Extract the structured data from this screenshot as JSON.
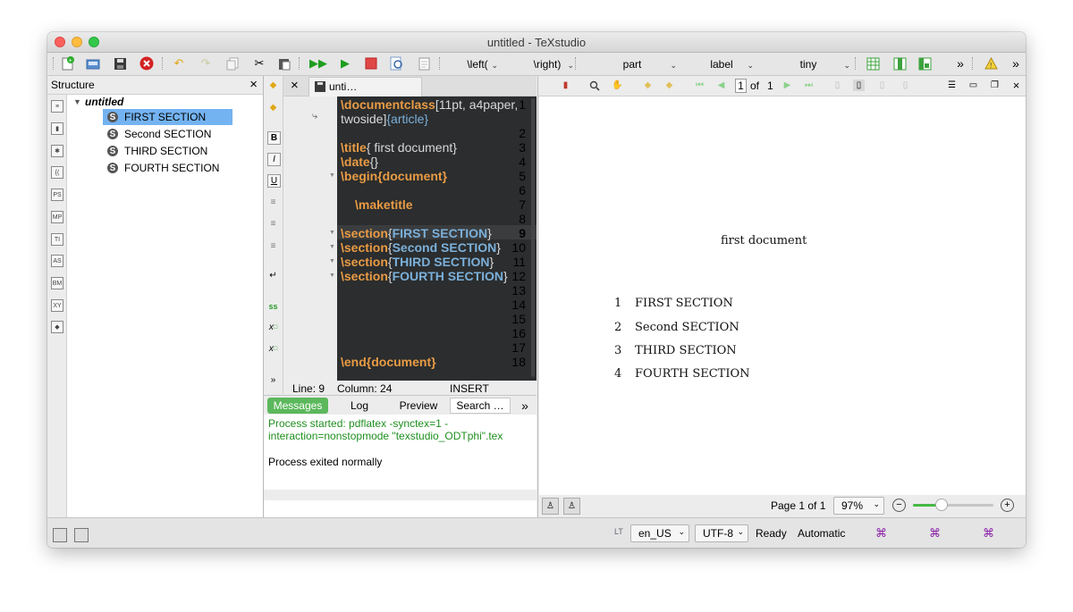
{
  "window": {
    "title": "untitled - TeXstudio"
  },
  "toolbar": {
    "left_cmd": "\\left(",
    "right_cmd": "\\right)",
    "sectioning": "part",
    "reference": "label",
    "size": "tiny",
    "more": "»"
  },
  "structure": {
    "title": "Structure",
    "close": "×",
    "root": "untitled",
    "items": [
      "FIRST SECTION",
      "Second SECTION",
      "THIRD SECTION",
      "FOURTH SECTION"
    ]
  },
  "editor": {
    "tab_close": "×",
    "tab_label": "unti…",
    "lines": [
      "1",
      "2",
      "3",
      "4",
      "5",
      "6",
      "7",
      "8",
      "9",
      "10",
      "11",
      "12",
      "13",
      "14",
      "15",
      "16",
      "17",
      "18"
    ],
    "code": {
      "l1a": "\\documentclass",
      "l1b": "[11pt, a4paper,",
      "l1c": "twoside]",
      "l1d": "{article}",
      "l3a": "\\title",
      "l3b": "{ first document}",
      "l4a": "\\date",
      "l4b": "{}",
      "l5a": "\\begin",
      "l5b": "{document}",
      "l7": "\\maketitle",
      "sec": "\\section",
      "s1": "FIRST SECTION",
      "s2": "Second SECTION",
      "s3": "THIRD SECTION",
      "s4": "FOURTH SECTION",
      "l18a": "\\end",
      "l18b": "{document}"
    },
    "status": {
      "line": "Line: 9",
      "column": "Column: 24",
      "mode": "INSERT"
    }
  },
  "messages": {
    "tabs": [
      "Messages",
      "Log",
      "Preview",
      "Search …"
    ],
    "more": "»",
    "started": "Process started: pdflatex -synctex=1 -interaction=nonstopmode \"texstudio_ODTphi\".tex",
    "exited": "Process exited normally"
  },
  "pdf": {
    "page_input": "1",
    "of_label": "of",
    "total": "1",
    "doc_title": "first document",
    "sections": [
      {
        "num": "1",
        "title": "FIRST SECTION"
      },
      {
        "num": "2",
        "title": "Second SECTION"
      },
      {
        "num": "3",
        "title": "THIRD SECTION"
      },
      {
        "num": "4",
        "title": "FOURTH SECTION"
      }
    ],
    "page_status": "Page 1 of 1",
    "zoom": "97%",
    "zoom_level": 0.35
  },
  "statusbar": {
    "language": "en_US",
    "encoding": "UTF-8",
    "ready": "Ready",
    "automatic": "Automatic"
  },
  "colors": {
    "accent": "#74b3f1",
    "keyword": "#e99b44",
    "argument": "#7bb0da",
    "message_green": "#1f8f1f",
    "editor_bg": "#2b2d2e"
  }
}
